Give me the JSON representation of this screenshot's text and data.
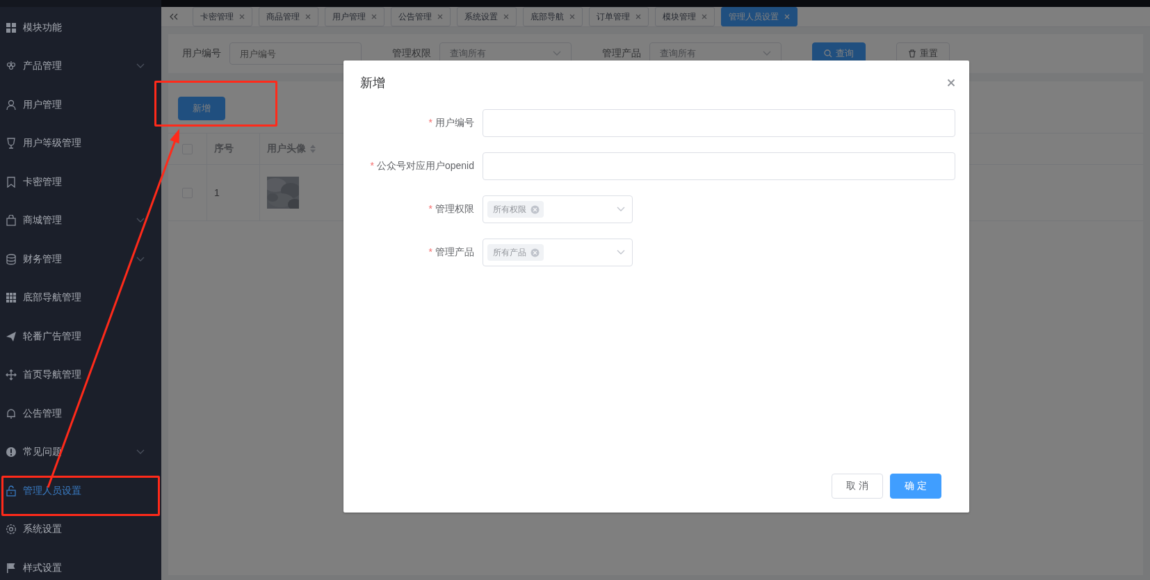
{
  "sidebar": {
    "items": [
      {
        "label": "模块功能",
        "selected": false,
        "collapsible": false
      },
      {
        "label": "产品管理",
        "selected": false,
        "collapsible": true
      },
      {
        "label": "用户管理",
        "selected": false,
        "collapsible": false
      },
      {
        "label": "用户等级管理",
        "selected": false,
        "collapsible": false
      },
      {
        "label": "卡密管理",
        "selected": false,
        "collapsible": false
      },
      {
        "label": "商城管理",
        "selected": false,
        "collapsible": true
      },
      {
        "label": "财务管理",
        "selected": false,
        "collapsible": true
      },
      {
        "label": "底部导航管理",
        "selected": false,
        "collapsible": false
      },
      {
        "label": "轮番广告管理",
        "selected": false,
        "collapsible": false
      },
      {
        "label": "首页导航管理",
        "selected": false,
        "collapsible": false
      },
      {
        "label": "公告管理",
        "selected": false,
        "collapsible": false
      },
      {
        "label": "常见问题",
        "selected": false,
        "collapsible": true
      },
      {
        "label": "管理人员设置",
        "selected": true,
        "collapsible": false
      },
      {
        "label": "系统设置",
        "selected": false,
        "collapsible": false
      },
      {
        "label": "样式设置",
        "selected": false,
        "collapsible": false
      }
    ]
  },
  "tabs": [
    {
      "label": "卡密管理",
      "selected": false
    },
    {
      "label": "商品管理",
      "selected": false
    },
    {
      "label": "用户管理",
      "selected": false
    },
    {
      "label": "公告管理",
      "selected": false
    },
    {
      "label": "系统设置",
      "selected": false
    },
    {
      "label": "底部导航",
      "selected": false
    },
    {
      "label": "订单管理",
      "selected": false
    },
    {
      "label": "模块管理",
      "selected": false
    },
    {
      "label": "管理人员设置",
      "selected": true
    }
  ],
  "filters": {
    "user_id_label": "用户编号",
    "user_id_placeholder": "用户编号",
    "permission_label": "管理权限",
    "permission_placeholder": "查询所有",
    "product_label": "管理产品",
    "product_placeholder": "查询所有",
    "search_button": "查询",
    "reset_button": "重置"
  },
  "add_button": "新增",
  "table": {
    "columns": [
      "序号",
      "用户头像"
    ],
    "select_all_checked": false,
    "rows": [
      {
        "checked": false,
        "index": "1"
      }
    ]
  },
  "dialog": {
    "title": "新增",
    "required_mark": "*",
    "fields": [
      {
        "kind": "input",
        "label": "用户编号",
        "required": true
      },
      {
        "kind": "input",
        "label": "公众号对应用户openid",
        "required": true
      },
      {
        "kind": "select",
        "label": "管理权限",
        "required": true,
        "tags": [
          "所有权限"
        ]
      },
      {
        "kind": "select",
        "label": "管理产品",
        "required": true,
        "tags": [
          "所有产品"
        ]
      }
    ],
    "buttons": [
      "取 消",
      "确 定"
    ]
  }
}
